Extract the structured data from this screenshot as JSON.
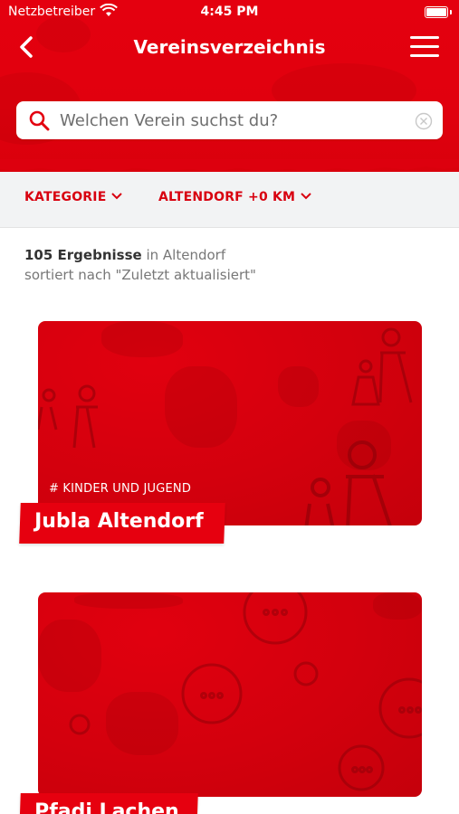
{
  "status_bar": {
    "carrier": "Netzbetreiber",
    "time": "4:45 PM"
  },
  "nav": {
    "title": "Vereinsverzeichnis"
  },
  "search": {
    "placeholder": "Welchen Verein suchst du?"
  },
  "filters": {
    "category": "KATEGORIE",
    "location": "ALTENDORF +0 KM"
  },
  "results": {
    "count": "105 Ergebnisse",
    "in_text": "in Altendorf",
    "sort_text": "sortiert nach \"Zuletzt aktualisiert\""
  },
  "cards": [
    {
      "tag": "# KINDER UND JUGEND",
      "name": "Jubla Altendorf"
    },
    {
      "tag": "",
      "name": "Pfadi Lachen"
    }
  ],
  "colors": {
    "brand_red": "#e3000f",
    "filter_bg": "#f2f3f4",
    "text_dark": "#333333"
  },
  "icons": [
    "wifi-icon",
    "battery-icon",
    "back-arrow-icon",
    "hamburger-menu-icon",
    "search-icon",
    "clear-icon",
    "chevron-down-icon"
  ]
}
